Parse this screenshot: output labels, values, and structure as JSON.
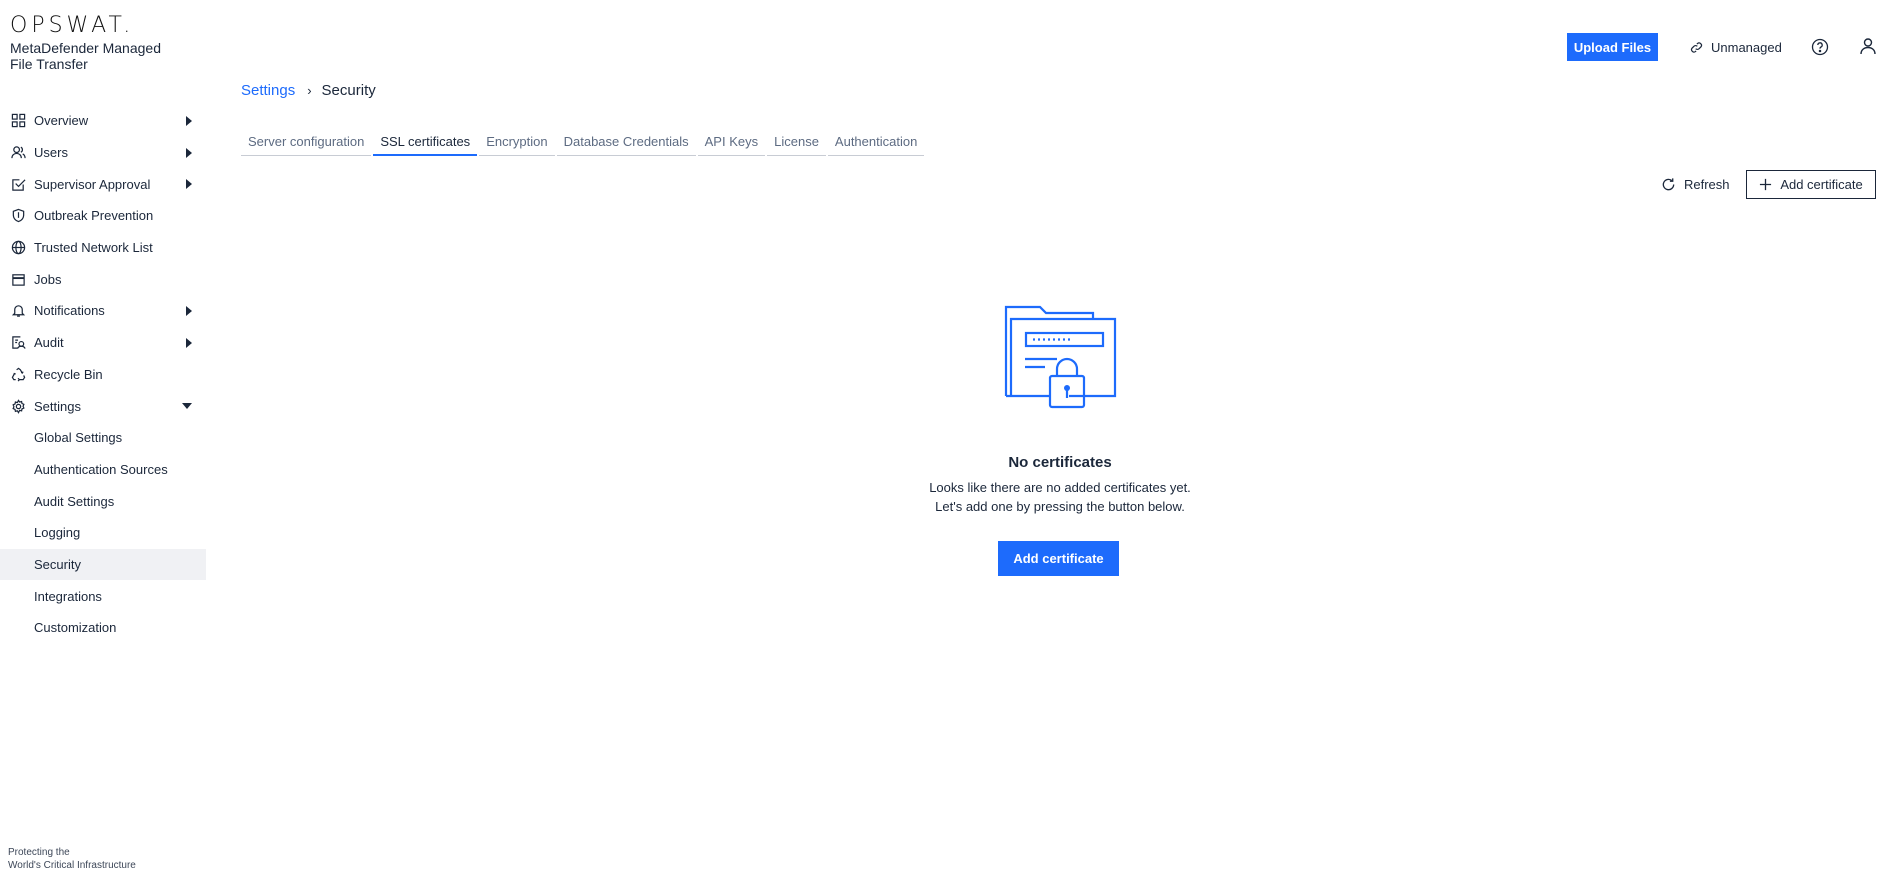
{
  "brand": {
    "logo": "OPSWAT.",
    "product": "MetaDefender Managed File Transfer",
    "tagline_line1": "Protecting the",
    "tagline_line2": "World's Critical Infrastructure"
  },
  "sidebar": {
    "items": [
      {
        "label": "Overview",
        "icon": "grid-icon",
        "arrow": "right"
      },
      {
        "label": "Users",
        "icon": "users-icon",
        "arrow": "right"
      },
      {
        "label": "Supervisor Approval",
        "icon": "checkbox-icon",
        "arrow": "right"
      },
      {
        "label": "Outbreak Prevention",
        "icon": "shield-icon",
        "arrow": ""
      },
      {
        "label": "Trusted Network List",
        "icon": "globe-icon",
        "arrow": ""
      },
      {
        "label": "Jobs",
        "icon": "calendar-icon",
        "arrow": ""
      },
      {
        "label": "Notifications",
        "icon": "bell-icon",
        "arrow": "right"
      },
      {
        "label": "Audit",
        "icon": "audit-icon",
        "arrow": "right"
      },
      {
        "label": "Recycle Bin",
        "icon": "recycle-icon",
        "arrow": ""
      },
      {
        "label": "Settings",
        "icon": "gear-icon",
        "arrow": "down"
      }
    ],
    "settings_sub": [
      {
        "label": "Global Settings"
      },
      {
        "label": "Authentication Sources"
      },
      {
        "label": "Audit Settings"
      },
      {
        "label": "Logging"
      },
      {
        "label": "Security",
        "active": true
      },
      {
        "label": "Integrations"
      },
      {
        "label": "Customization"
      }
    ]
  },
  "header": {
    "upload_label": "Upload Files",
    "unmanaged_label": "Unmanaged"
  },
  "breadcrumb": {
    "parent": "Settings",
    "separator": "›",
    "current": "Security"
  },
  "tabs": [
    {
      "label": "Server configuration"
    },
    {
      "label": "SSL certificates",
      "active": true
    },
    {
      "label": "Encryption"
    },
    {
      "label": "Database Credentials"
    },
    {
      "label": "API Keys"
    },
    {
      "label": "License"
    },
    {
      "label": "Authentication"
    }
  ],
  "actions": {
    "refresh_label": "Refresh",
    "add_certificate_label": "Add certificate"
  },
  "empty_state": {
    "title": "No certificates",
    "line1": "Looks like there are no added certificates yet.",
    "line2": "Let's add one by pressing the button below.",
    "button_label": "Add certificate"
  },
  "colors": {
    "accent": "#1d6bfc",
    "text": "#1b273a",
    "active_bg": "#f0f1f4"
  }
}
